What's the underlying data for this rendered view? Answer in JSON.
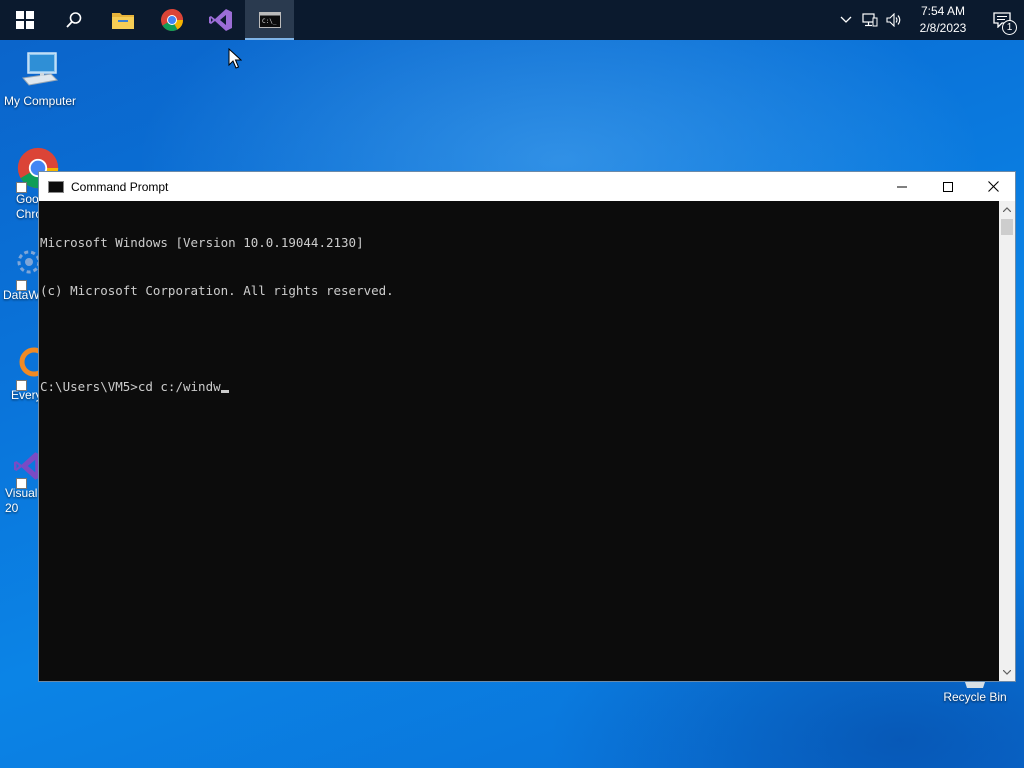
{
  "taskbar": {
    "items": [
      {
        "name": "start",
        "icon": "windows-logo-icon"
      },
      {
        "name": "search",
        "icon": "search-icon"
      },
      {
        "name": "file-explorer",
        "icon": "folder-icon"
      },
      {
        "name": "chrome",
        "icon": "chrome-icon"
      },
      {
        "name": "visual-studio",
        "icon": "visual-studio-icon"
      },
      {
        "name": "command-prompt",
        "icon": "cmd-icon",
        "active": true
      }
    ],
    "clock": {
      "time": "7:54 AM",
      "date": "2/8/2023"
    },
    "notification_count": "1"
  },
  "desktop": {
    "icons": [
      {
        "label": "My Computer"
      },
      {
        "label": "Goo\nChro"
      },
      {
        "label": "DataW"
      },
      {
        "label": "Every"
      },
      {
        "label": "Visual\n20"
      },
      {
        "label": "Recycle Bin"
      }
    ]
  },
  "window": {
    "title": "Command Prompt",
    "console_lines": [
      "Microsoft Windows [Version 10.0.19044.2130]",
      "(c) Microsoft Corporation. All rights reserved.",
      "",
      "C:\\Users\\VM5>cd c:/windw"
    ]
  },
  "colors": {
    "taskbar_bg": "#0b1a2e",
    "console_bg": "#0c0c0c",
    "console_text": "#cccccc",
    "desktop_blue": "#0a74da"
  }
}
